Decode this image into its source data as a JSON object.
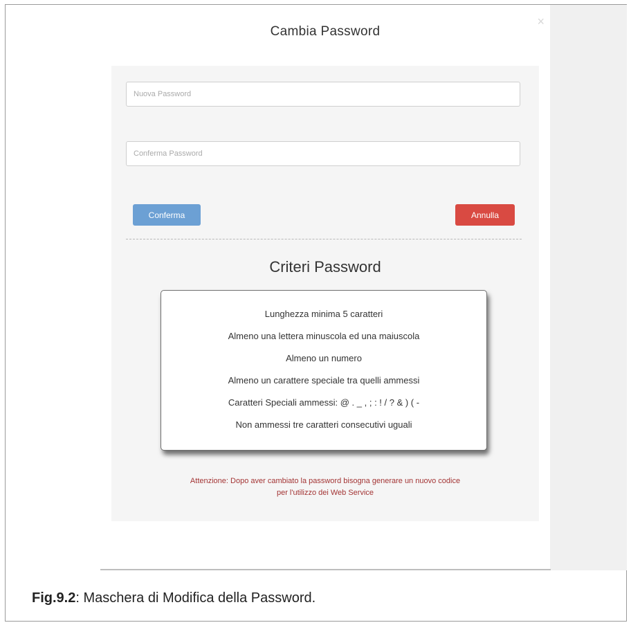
{
  "modal": {
    "title": "Cambia Password",
    "close_symbol": "×",
    "new_password_placeholder": "Nuova Password",
    "confirm_password_placeholder": "Conferma Password",
    "confirm_button": "Conferma",
    "cancel_button": "Annulla",
    "criteria_title": "Criteri Password",
    "criteria": [
      "Lunghezza minima 5 caratteri",
      "Almeno una lettera minuscola ed una maiuscola",
      "Almeno un numero",
      "Almeno un carattere speciale tra quelli ammessi",
      "Caratteri Speciali ammessi: @ . _ , ; : ! / ? & ) ( -",
      "Non ammessi tre caratteri consecutivi uguali"
    ],
    "warning_line1": "Attenzione: Dopo aver cambiato la password bisogna generare un nuovo codice",
    "warning_line2": "per l'utilizzo dei Web Service"
  },
  "caption": {
    "figure_label": "Fig.9.2",
    "text": ": Maschera di Modifica della Password."
  },
  "colors": {
    "confirm_button": "#6ca0d4",
    "cancel_button": "#d94a42",
    "warning_text": "#a33434"
  }
}
